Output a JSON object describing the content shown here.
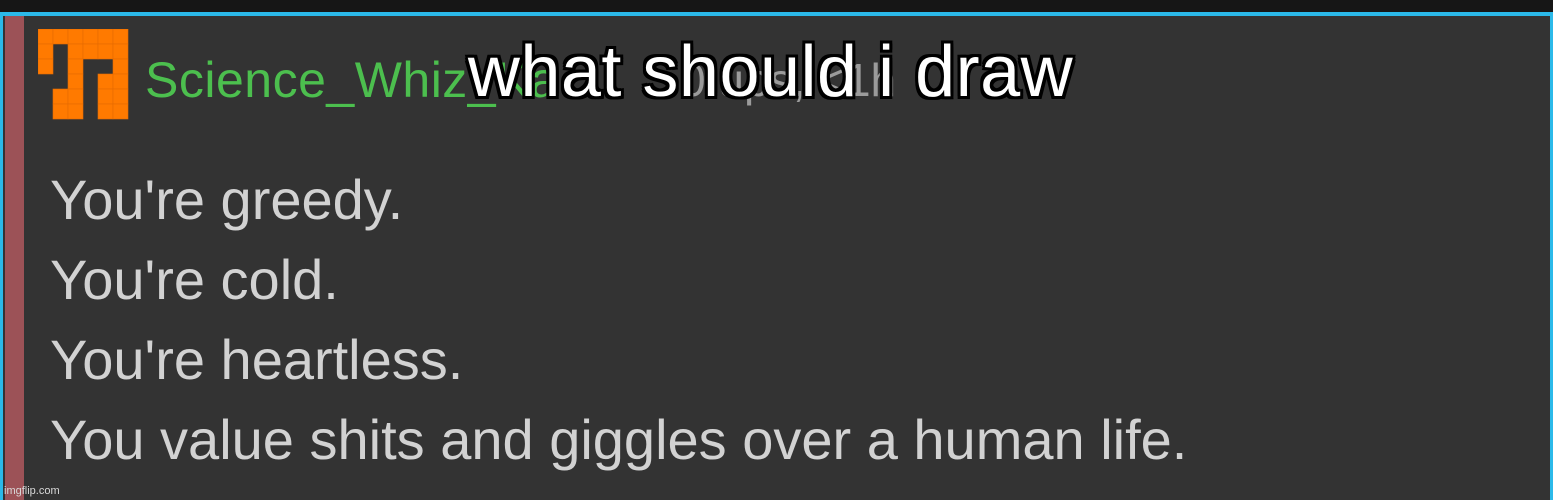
{
  "caption": {
    "text": "what should i draw"
  },
  "post": {
    "username": "Science_Whiz_Ka",
    "meta": "0 ups, <1h",
    "username_color": "#4cbf4e",
    "accent_color": "#9c5257",
    "message_lines": [
      "You're greedy.",
      "You're cold.",
      "You're heartless.",
      "You value shits and giggles over a human life."
    ]
  },
  "avatar": {
    "icon": "orange-pixel-avatar",
    "color": "#ff7a00"
  },
  "watermark": {
    "text": "imgflip.com"
  }
}
